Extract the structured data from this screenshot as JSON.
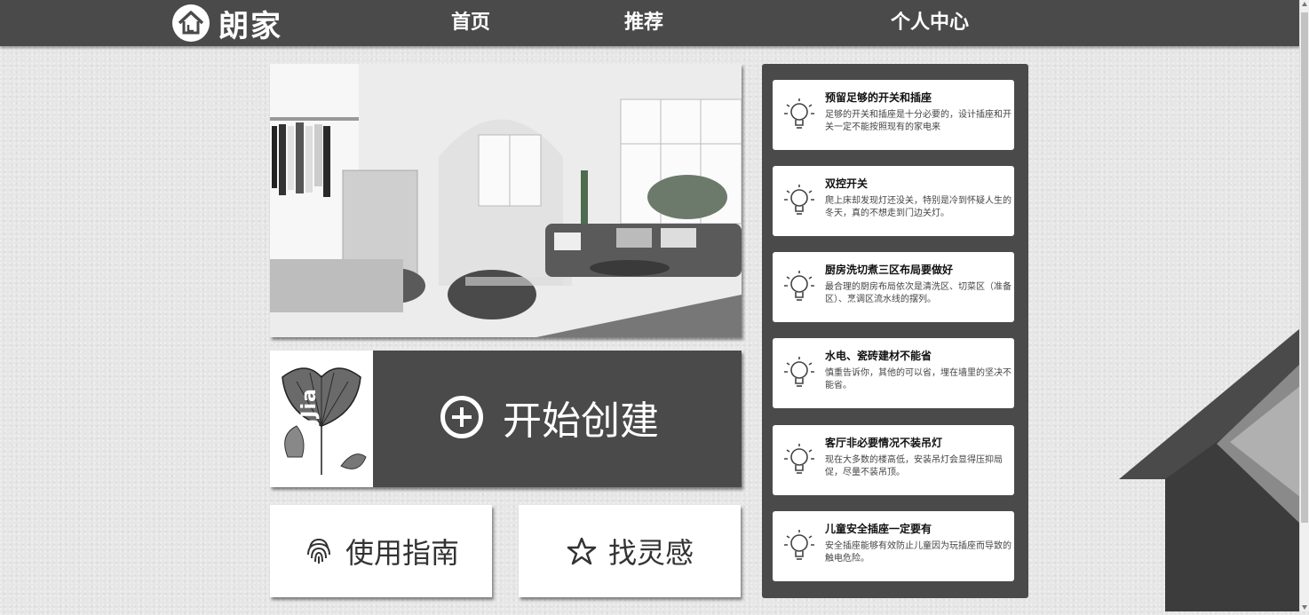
{
  "header": {
    "logo_text": "朗家",
    "nav": [
      {
        "label": "首页"
      },
      {
        "label": "推荐"
      },
      {
        "label": "个人中心"
      }
    ]
  },
  "create_card": {
    "thumb_text": "LangJia",
    "label": "开始创建"
  },
  "actions": [
    {
      "label": "使用指南",
      "icon": "fingerprint-icon"
    },
    {
      "label": "找灵感",
      "icon": "star-outline-icon"
    }
  ],
  "tips": [
    {
      "title": "预留足够的开关和插座",
      "desc": "足够的开关和插座是十分必要的，设计插座和开关一定不能按照现有的家电来"
    },
    {
      "title": "双控开关",
      "desc": "爬上床却发现灯还没关，特别是冷到怀疑人生的冬天，真的不想走到门边关灯。"
    },
    {
      "title": "厨房洗切煮三区布局要做好",
      "desc": "最合理的厨房布局依次是清洗区、切菜区（准备区）、烹调区流水线的摆列。"
    },
    {
      "title": "水电、瓷砖建材不能省",
      "desc": "慎重告诉你，其他的可以省，埋在墙里的坚决不能省。"
    },
    {
      "title": "客厅非必要情况不装吊灯",
      "desc": "现在大多数的楼高低，安装吊灯会显得压抑局促，尽量不装吊顶。"
    },
    {
      "title": "儿童安全插座一定要有",
      "desc": "安全插座能够有效防止儿童因为玩插座而导致的触电危险。"
    }
  ],
  "colors": {
    "header_bg": "#4a4a4a",
    "card_dark": "#4a4a4a",
    "page_bg": "#e6e6e6"
  }
}
